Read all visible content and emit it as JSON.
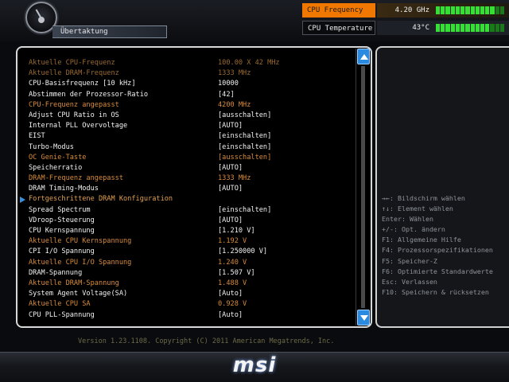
{
  "header": {
    "page_title": "Übertaktung",
    "cpu_frequency": {
      "label": "CPU Frequency",
      "value": "4.20 GHz",
      "level": 0.85
    },
    "cpu_temperature": {
      "label": "CPU Temperature",
      "value": "43°C",
      "level": 0.75
    }
  },
  "settings": [
    {
      "label": "Aktuelle CPU-Frequenz",
      "value": "100.00 X 42 MHz",
      "type": "dim"
    },
    {
      "label": "Aktuelle DRAM-Frequenz",
      "value": "1333 MHz",
      "type": "dim"
    },
    {
      "label": "CPU-Basisfrequenz [10 kHz]",
      "value": "10000",
      "type": "set"
    },
    {
      "label": "Abstimmen der Prozessor-Ratio",
      "value": "[42]",
      "type": "set"
    },
    {
      "label": "CPU-Frequenz angepasst",
      "value": "4200 MHz",
      "type": "info"
    },
    {
      "label": "Adjust CPU Ratio in OS",
      "value": "[ausschalten]",
      "type": "set"
    },
    {
      "label": "Internal PLL Overvoltage",
      "value": "[AUTO]",
      "type": "set"
    },
    {
      "label": "EIST",
      "value": "[einschalten]",
      "type": "set"
    },
    {
      "label": "Turbo-Modus",
      "value": "[einschalten]",
      "type": "set"
    },
    {
      "label": "OC Genie-Taste",
      "value": "[ausschalten]",
      "type": "info"
    },
    {
      "label": "Speicherratio",
      "value": "[AUTO]",
      "type": "set"
    },
    {
      "label": "DRAM-Frequenz angepasst",
      "value": "1333 MHz",
      "type": "info"
    },
    {
      "label": "DRAM Timing-Modus",
      "value": "[AUTO]",
      "type": "set"
    },
    {
      "label": "Fortgeschrittene DRAM Konfiguration",
      "value": "",
      "type": "submenu"
    },
    {
      "label": "Spread Spectrum",
      "value": "[einschalten]",
      "type": "set"
    },
    {
      "label": "VDroop-Steuerung",
      "value": "[AUTO]",
      "type": "set"
    },
    {
      "label": "CPU Kernspannung",
      "value": "[1.210 V]",
      "type": "set"
    },
    {
      "label": "Aktuelle CPU Kernspannung",
      "value": "1.192 V",
      "type": "info"
    },
    {
      "label": "CPI I/O Spannung",
      "value": "[1.250000 V]",
      "type": "set"
    },
    {
      "label": "Aktuelle CPU I/O Spannung",
      "value": "1.240 V",
      "type": "info"
    },
    {
      "label": "DRAM-Spannung",
      "value": "[1.507 V]",
      "type": "set"
    },
    {
      "label": "Aktuelle DRAM-Spannung",
      "value": "1.488 V",
      "type": "info"
    },
    {
      "label": "System Agent Voltage(SA)",
      "value": "[Auto]",
      "type": "set"
    },
    {
      "label": "Aktuelle CPU SA",
      "value": "0.928 V",
      "type": "info"
    },
    {
      "label": "CPU PLL-Spannung",
      "value": "[Auto]",
      "type": "set"
    }
  ],
  "help": [
    "→←: Bildschirm wählen",
    "↑↓: Element wählen",
    "Enter: Wählen",
    "+/-: Opt. ändern",
    "F1: Allgemeine Hilfe",
    "F4: Prozessorspezifikationen",
    "F5: Speicher-Z",
    "F6: Optimierte Standardwerte",
    "Esc: Verlassen",
    "F10: Speichern & rücksetzen"
  ],
  "footer": {
    "version": "Version 1.23.1108. Copyright (C) 2011 American Megatrends, Inc.",
    "logo": "msi"
  },
  "colors": {
    "accent_orange": "#f07800",
    "scroll_blue": "#2a8ae0",
    "bar_green": "#35e035"
  }
}
